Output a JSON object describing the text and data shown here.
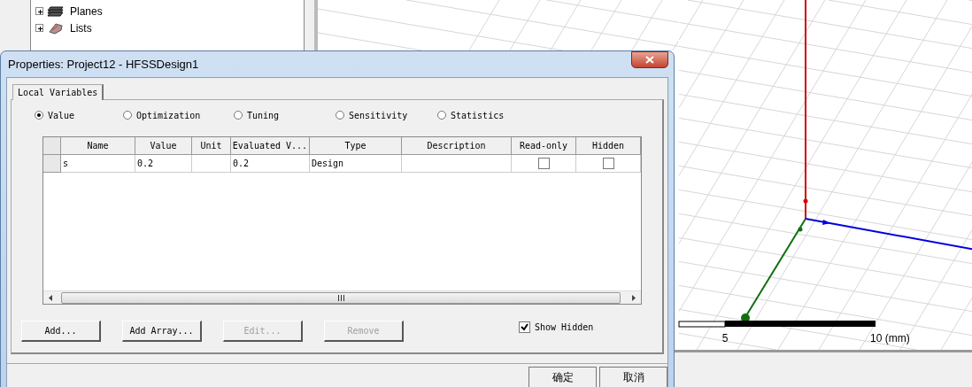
{
  "tree": {
    "items": [
      {
        "label": "Planes",
        "expanded": false,
        "kind": "planes"
      },
      {
        "label": "Lists",
        "expanded": false,
        "kind": "lists"
      }
    ]
  },
  "viewport": {
    "scale_labels": [
      "5",
      "10 (mm)"
    ]
  },
  "dialog": {
    "title": "Properties: Project12 - HFSSDesign1",
    "tabs": [
      {
        "label": "Local Variables",
        "selected": true
      }
    ],
    "modes": [
      {
        "label": "Value",
        "selected": true
      },
      {
        "label": "Optimization",
        "selected": false
      },
      {
        "label": "Tuning",
        "selected": false
      },
      {
        "label": "Sensitivity",
        "selected": false
      },
      {
        "label": "Statistics",
        "selected": false
      }
    ],
    "table": {
      "columns": [
        "Name",
        "Value",
        "Unit",
        "Evaluated V...",
        "Type",
        "Description",
        "Read-only",
        "Hidden"
      ],
      "rows": [
        {
          "name": "s",
          "value": "0.2",
          "evaluated": "0.2",
          "type": "Design",
          "read_only": false,
          "hidden": false
        }
      ]
    },
    "buttons": [
      {
        "label": "Add...",
        "disabled": false
      },
      {
        "label": "Add Array...",
        "disabled": false
      },
      {
        "label": "Edit...",
        "disabled": true
      },
      {
        "label": "Remove",
        "disabled": true
      }
    ],
    "show_hidden": {
      "label": "Show Hidden",
      "checked": true
    },
    "footer_buttons": [
      "确定",
      "取消"
    ]
  }
}
